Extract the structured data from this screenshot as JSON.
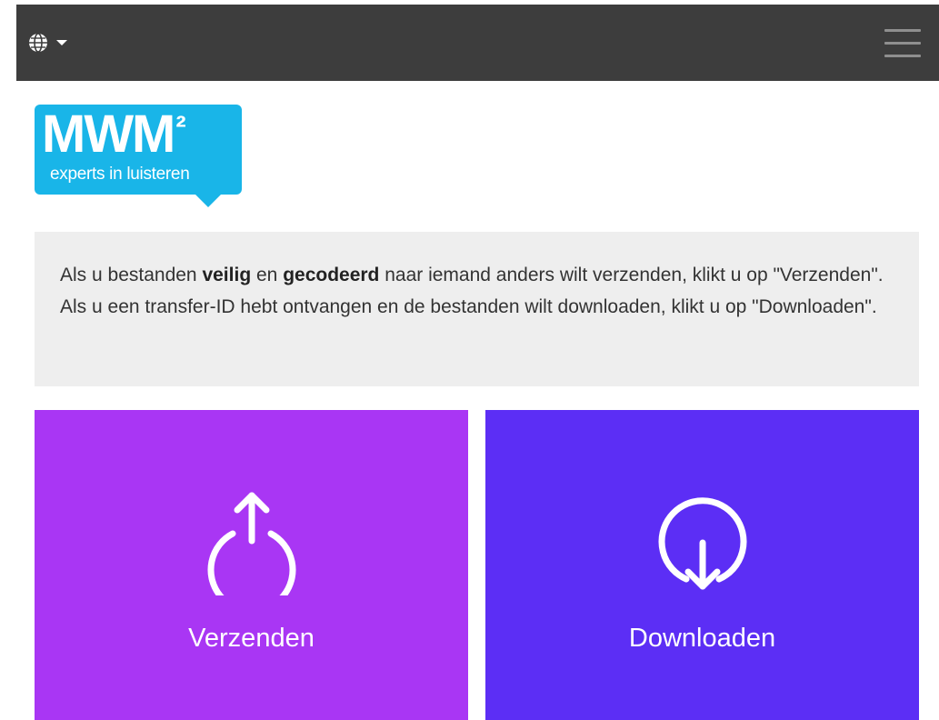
{
  "header": {
    "language_icon": "globe-icon",
    "language_dropdown_icon": "caret-down-icon",
    "menu_icon": "hamburger-icon",
    "background_color": "#3d3d3d"
  },
  "logo": {
    "mark": "MWM",
    "superscript": "²",
    "tagline": "experts in luisteren",
    "color": "#19b5e8"
  },
  "intro": {
    "part1": "Als u bestanden ",
    "bold1": "veilig",
    "part2": " en ",
    "bold2": "gecodeerd",
    "part3": " naar iemand anders wilt verzenden, klikt u op \"Verzenden\". Als u een transfer-ID hebt ontvangen en de bestanden wilt downloaden, klikt u op \"Downloaden\"."
  },
  "actions": {
    "send": {
      "label": "Verzenden",
      "icon": "upload-icon",
      "color": "#a936f4"
    },
    "download": {
      "label": "Downloaden",
      "icon": "download-icon",
      "color": "#5c2ef5"
    }
  }
}
